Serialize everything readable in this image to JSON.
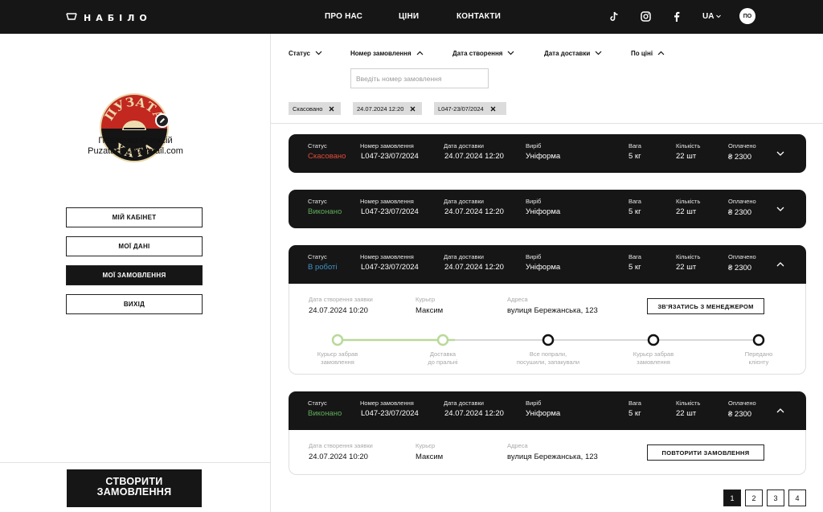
{
  "brand": {
    "name": "НАБІЛО"
  },
  "nav": {
    "about": "ПРО НАС",
    "prices": "ЦІНИ",
    "contacts": "КОНТАКТИ",
    "lang": "UA",
    "user_initials": "ПО"
  },
  "profile": {
    "logo_text_top": "ПУЗАТА",
    "logo_text_bottom": "ХАТА",
    "name": "Павленко Олексій",
    "email": "PuzataHata@gmail.com"
  },
  "menu": {
    "cabinet": "МІЙ КАБІНЕТ",
    "data": "МОЇ ДАНІ",
    "orders": "МОЇ ЗАМОВЛЕННЯ",
    "logout": "ВИХІД"
  },
  "create_order": {
    "line1": "СТВОРИТИ",
    "line2": "ЗАМОВЛЕННЯ"
  },
  "filters": {
    "status": "Статус",
    "order_number": "Номер замовлення",
    "created": "Дата створення",
    "delivery": "Дата доставки",
    "price": "По ціні",
    "search_placeholder": "Введіть номер замовлення",
    "chips": [
      "Скасовано",
      "24.07.2024 12:20",
      "L047-23/07/2024"
    ]
  },
  "labels": {
    "status": "Статус",
    "order_number": "Номер замовлення",
    "delivery_date": "Дата доставки",
    "product": "Виріб",
    "weight": "Вага",
    "quantity": "Кількість",
    "paid": "Оплачено",
    "created": "Дата створення заявки",
    "courier": "Курьєр",
    "address": "Адреса"
  },
  "orders": [
    {
      "status": "Скасовано",
      "status_color": "#e14b3b",
      "number": "L047-23/07/2024",
      "delivery": "24.07.2024 12:20",
      "product": "Уніформа",
      "weight": "5 кг",
      "quantity": "22 шт",
      "paid": "₴ 2300"
    },
    {
      "status": "Виконано",
      "status_color": "#5fae5a",
      "number": "L047-23/07/2024",
      "delivery": "24.07.2024 12:20",
      "product": "Уніформа",
      "weight": "5 кг",
      "quantity": "22 шт",
      "paid": "₴ 2300"
    },
    {
      "status": "В роботі",
      "status_color": "#3f93c8",
      "number": "L047-23/07/2024",
      "delivery": "24.07.2024 12:20",
      "product": "Уніформа",
      "weight": "5 кг",
      "quantity": "22 шт",
      "paid": "₴ 2300",
      "created": "24.07.2024 10:20",
      "courier": "Максим",
      "address": "вулиця Бережанська, 123",
      "action": "ЗВ'ЯЗАТИСЬ З МЕНЕДЖЕРОМ"
    },
    {
      "status": "Виконано",
      "status_color": "#5fae5a",
      "number": "L047-23/07/2024",
      "delivery": "24.07.2024 12:20",
      "product": "Уніформа",
      "weight": "5 кг",
      "quantity": "22 шт",
      "paid": "₴ 2300",
      "created": "24.07.2024 10:20",
      "courier": "Максим",
      "address": "вулиця Бережанська, 123",
      "action": "ПОВТОРИТИ ЗАМОВЛЕННЯ"
    }
  ],
  "progress": {
    "completed_steps": 2,
    "steps": [
      [
        "Курьєр забрав",
        "замовлення"
      ],
      [
        "Доставка",
        "до пральні"
      ],
      [
        "Все попрали,",
        "посушили, запакували"
      ],
      [
        "Курьєр забрав",
        "замовлення"
      ],
      [
        "Передано",
        "клієнту"
      ]
    ]
  },
  "pagination": [
    "1",
    "2",
    "3",
    "4"
  ],
  "colors": {
    "dark": "#161616",
    "progress_done": "#b9d99a",
    "status_cancelled": "#e14b3b",
    "status_done": "#5fae5a",
    "status_in_progress": "#3f93c8"
  }
}
